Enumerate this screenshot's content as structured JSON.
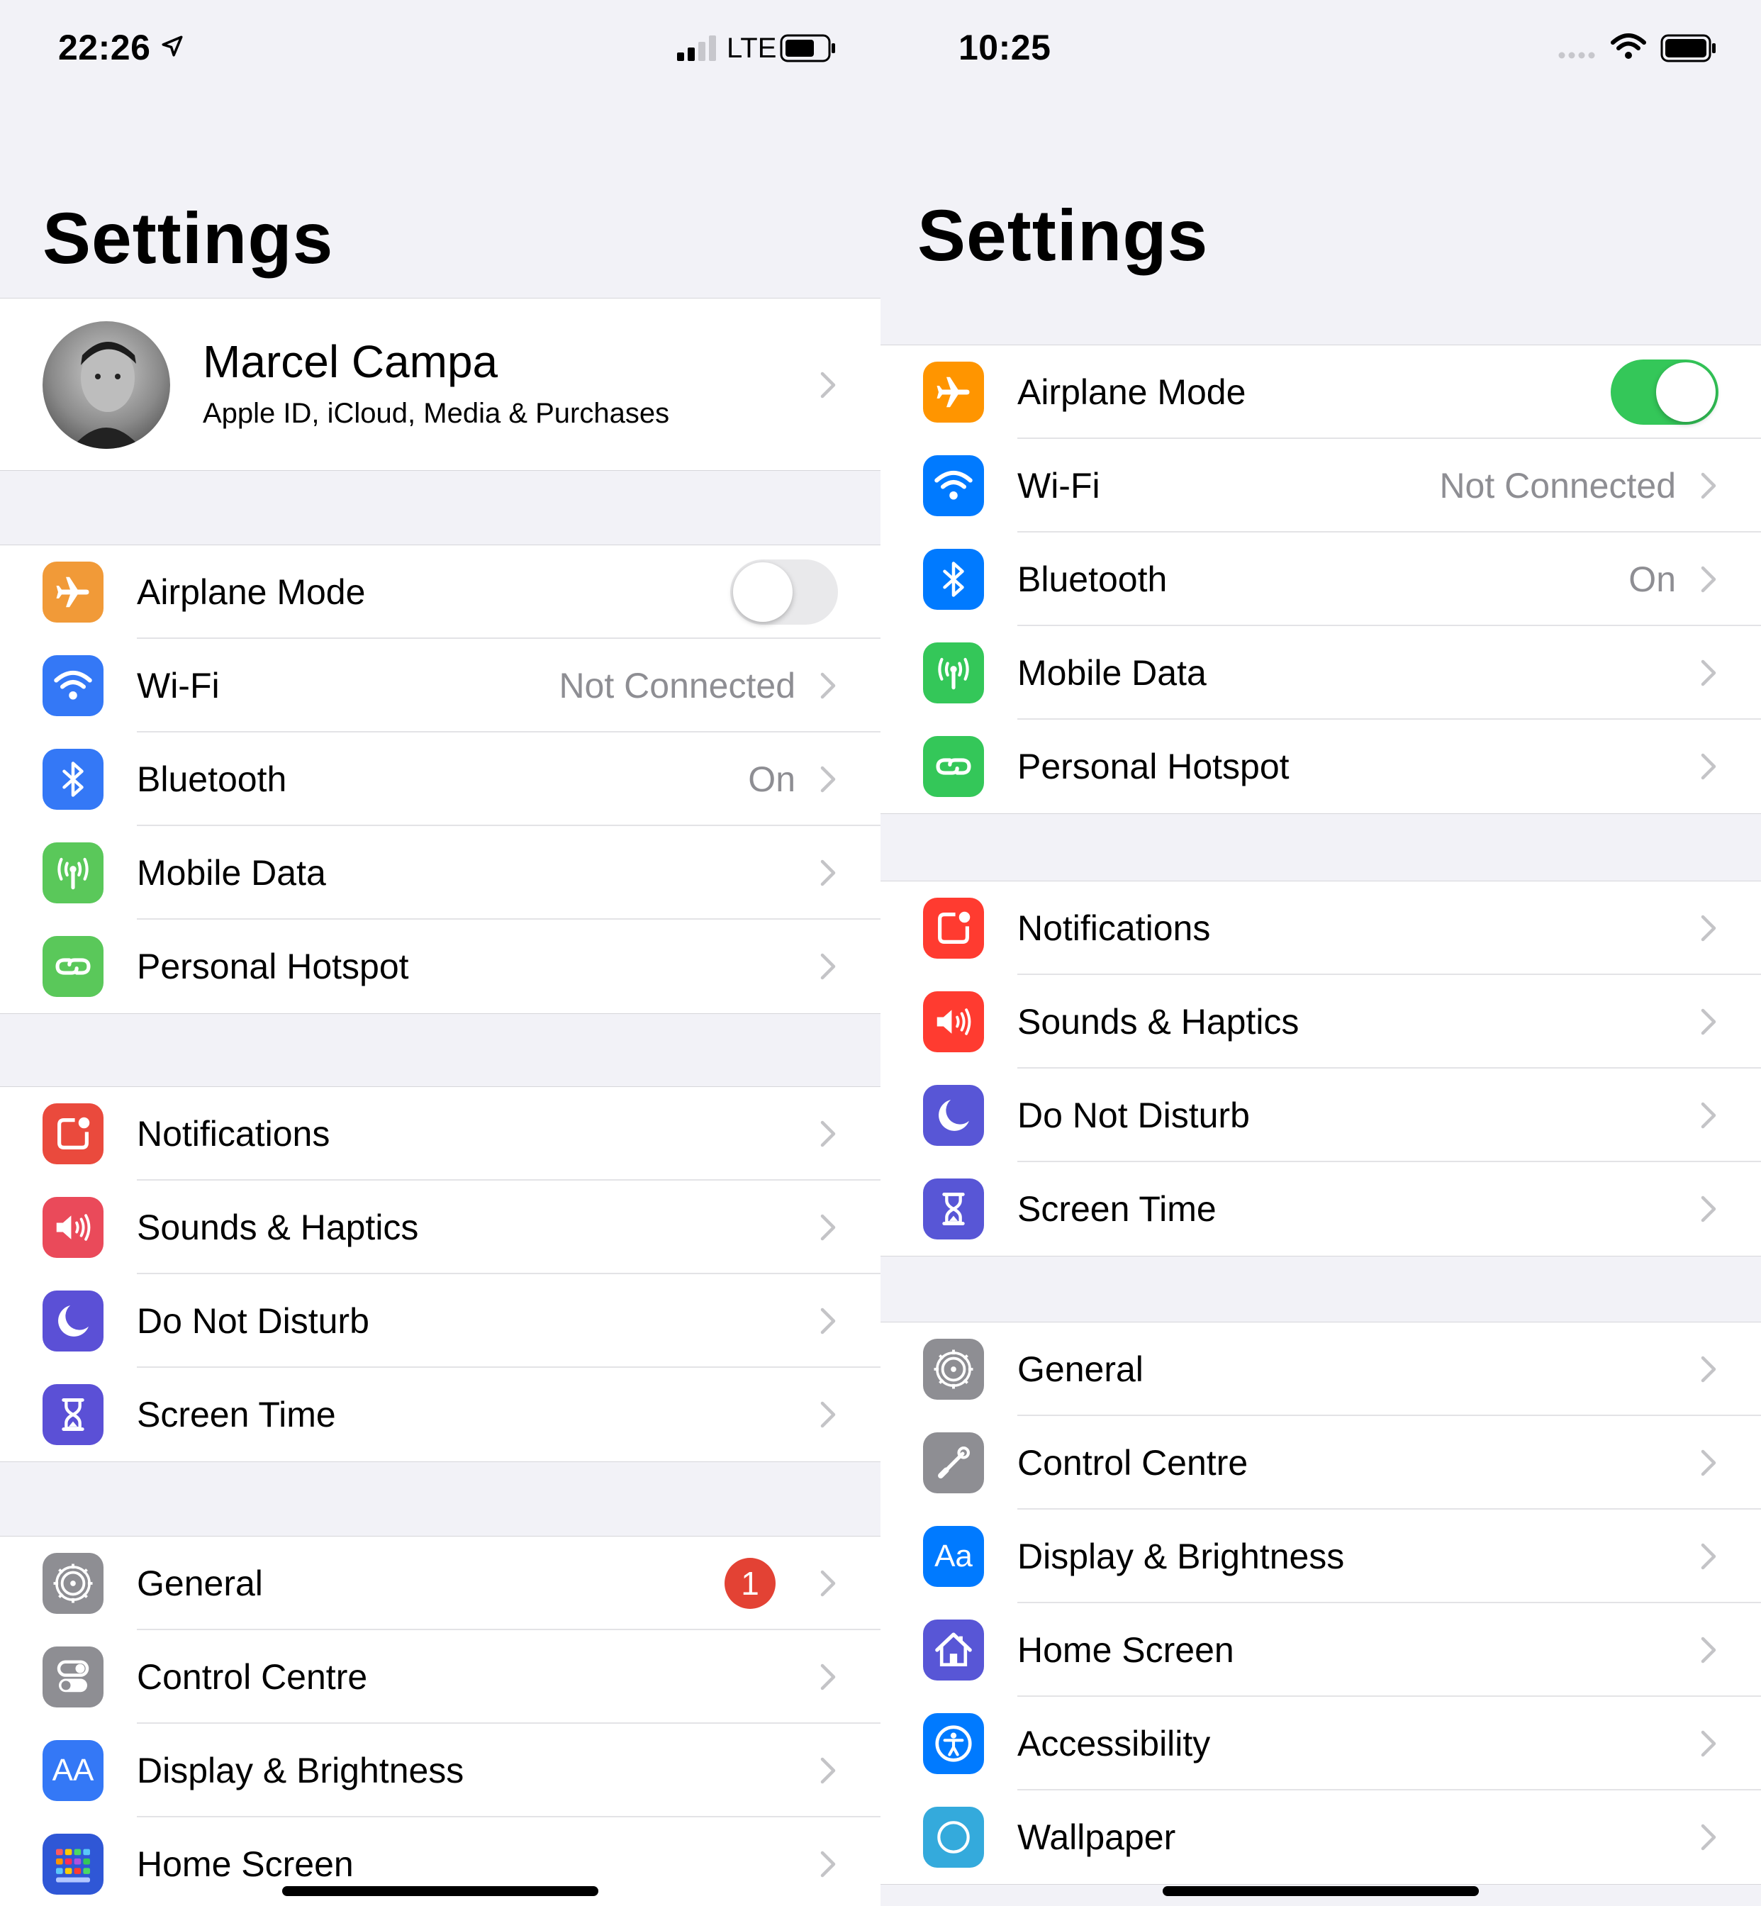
{
  "left": {
    "status": {
      "time": "22:26",
      "network": "LTE"
    },
    "title": "Settings",
    "profile": {
      "name": "Marcel Campa",
      "subtitle": "Apple ID, iCloud, Media & Purchases"
    },
    "group1": [
      {
        "label": "Airplane Mode",
        "icon": "airplane-icon",
        "color": "#f19a38",
        "toggle": false
      },
      {
        "label": "Wi-Fi",
        "value": "Not Connected",
        "icon": "wifi-icon",
        "color": "#3478f6"
      },
      {
        "label": "Bluetooth",
        "value": "On",
        "icon": "bluetooth-icon",
        "color": "#3478f6"
      },
      {
        "label": "Mobile Data",
        "icon": "antenna-icon",
        "color": "#5ac85a"
      },
      {
        "label": "Personal Hotspot",
        "icon": "hotspot-icon",
        "color": "#5ac85a"
      }
    ],
    "group2": [
      {
        "label": "Notifications",
        "icon": "notifications-icon",
        "color": "#ea4a3d"
      },
      {
        "label": "Sounds & Haptics",
        "icon": "speaker-icon",
        "color": "#ea4a5a"
      },
      {
        "label": "Do Not Disturb",
        "icon": "moon-icon",
        "color": "#5b50d6"
      },
      {
        "label": "Screen Time",
        "icon": "hourglass-icon",
        "color": "#5b50d6"
      }
    ],
    "group3": [
      {
        "label": "General",
        "icon": "gear-icon",
        "color": "#8e8e93",
        "badge": "1"
      },
      {
        "label": "Control Centre",
        "icon": "toggles-icon",
        "color": "#8e8e93"
      },
      {
        "label": "Display & Brightness",
        "icon": "text-size-icon",
        "color": "#3478f6",
        "glyph": "AA"
      },
      {
        "label": "Home Screen",
        "icon": "app-grid-icon",
        "color": "#2f57d6"
      }
    ]
  },
  "right": {
    "status": {
      "time": "10:25"
    },
    "title": "Settings",
    "group1": [
      {
        "label": "Airplane Mode",
        "icon": "airplane-icon",
        "color": "#ff9500",
        "toggle": true
      },
      {
        "label": "Wi-Fi",
        "value": "Not Connected",
        "icon": "wifi-icon",
        "color": "#007aff"
      },
      {
        "label": "Bluetooth",
        "value": "On",
        "icon": "bluetooth-icon",
        "color": "#007aff"
      },
      {
        "label": "Mobile Data",
        "icon": "antenna-icon",
        "color": "#34c759"
      },
      {
        "label": "Personal Hotspot",
        "icon": "hotspot-icon",
        "color": "#34c759"
      }
    ],
    "group2": [
      {
        "label": "Notifications",
        "icon": "notifications-icon",
        "color": "#ff3b30"
      },
      {
        "label": "Sounds & Haptics",
        "icon": "speaker-icon",
        "color": "#ff3b30"
      },
      {
        "label": "Do Not Disturb",
        "icon": "moon-icon",
        "color": "#5856d6"
      },
      {
        "label": "Screen Time",
        "icon": "hourglass-icon",
        "color": "#5856d6"
      }
    ],
    "group3": [
      {
        "label": "General",
        "icon": "gear-icon",
        "color": "#8e8e93"
      },
      {
        "label": "Control Centre",
        "icon": "slider-icon",
        "color": "#8e8e93"
      },
      {
        "label": "Display & Brightness",
        "icon": "text-size-icon",
        "color": "#007aff",
        "glyph": "Aa"
      },
      {
        "label": "Home Screen",
        "icon": "house-icon",
        "color": "#5856d6"
      },
      {
        "label": "Accessibility",
        "icon": "accessibility-icon",
        "color": "#007aff"
      },
      {
        "label": "Wallpaper",
        "icon": "wallpaper-icon",
        "color": "#34aadc"
      }
    ]
  }
}
